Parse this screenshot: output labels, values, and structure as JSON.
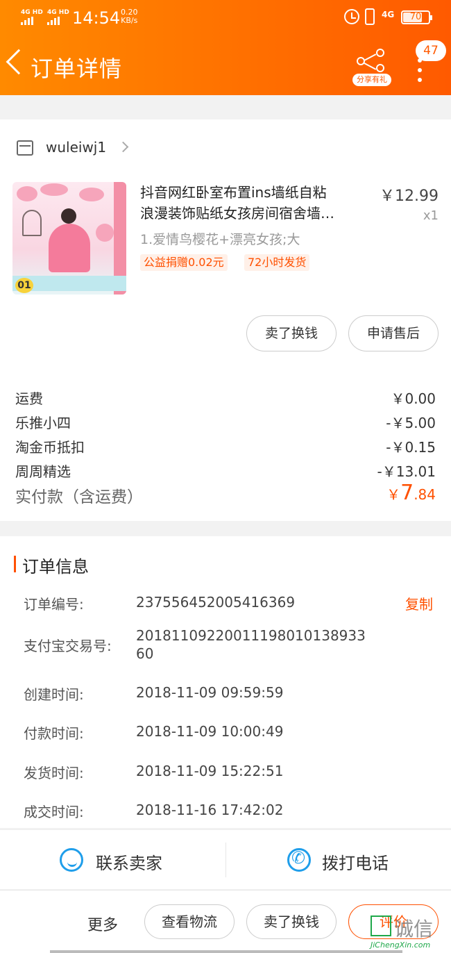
{
  "status_bar": {
    "sim1": "4G HD",
    "sim2": "4G HD",
    "time": "14:54",
    "speed_value": "0.20",
    "speed_unit": "KB/s",
    "network": "4G",
    "battery": "70"
  },
  "header": {
    "title": "订单详情",
    "share_label": "分享有礼",
    "notification_count": "47"
  },
  "shop": {
    "name": "wuleiwj1"
  },
  "item": {
    "title_line1": "抖音网红卧室布置ins墙纸自粘",
    "title_line2": "浪漫装饰贴纸女孩房间宿舍墙…",
    "price": "￥12.99",
    "quantity": "x1",
    "sku": "1.爱情鸟樱花+漂亮女孩;大",
    "tag_charity": "公益捐赠0.02元",
    "tag_shipping": "72小时发货",
    "thumb_number": "01",
    "actions": [
      "卖了换钱",
      "申请售后"
    ]
  },
  "fees": [
    {
      "label": "运费",
      "value": "￥0.00"
    },
    {
      "label": "乐推小四",
      "value": "-￥5.00"
    },
    {
      "label": "淘金币抵扣",
      "value": "-￥0.15"
    },
    {
      "label": "周周精选",
      "value": "-￥13.01"
    }
  ],
  "total": {
    "label": "实付款（含运费）",
    "currency": "￥",
    "integer": "7",
    "decimal": ".84"
  },
  "order_info": {
    "section_title": "订单信息",
    "copy_label": "复制",
    "rows": [
      {
        "key": "订单编号:",
        "value": "237556452005416369"
      },
      {
        "key": "支付宝交易号:",
        "value": "2018110922001119801013893360"
      },
      {
        "key": "创建时间:",
        "value": "2018-11-09 09:59:59"
      },
      {
        "key": "付款时间:",
        "value": "2018-11-09 10:00:49"
      },
      {
        "key": "发货时间:",
        "value": "2018-11-09 15:22:51"
      },
      {
        "key": "成交时间:",
        "value": "2018-11-16 17:42:02"
      }
    ]
  },
  "contact": {
    "seller": "联系卖家",
    "phone": "拨打电话"
  },
  "bottom_bar": {
    "more": "更多",
    "buttons": [
      "查看物流",
      "卖了换钱",
      "评价"
    ]
  },
  "watermark": {
    "text": "诚信",
    "url": "JiChengXin.com"
  },
  "colors": {
    "accent": "#ff5000",
    "header_gradient_start": "#ff8a00",
    "header_gradient_end": "#ff5a00",
    "contact_icon": "#1f9eea"
  }
}
